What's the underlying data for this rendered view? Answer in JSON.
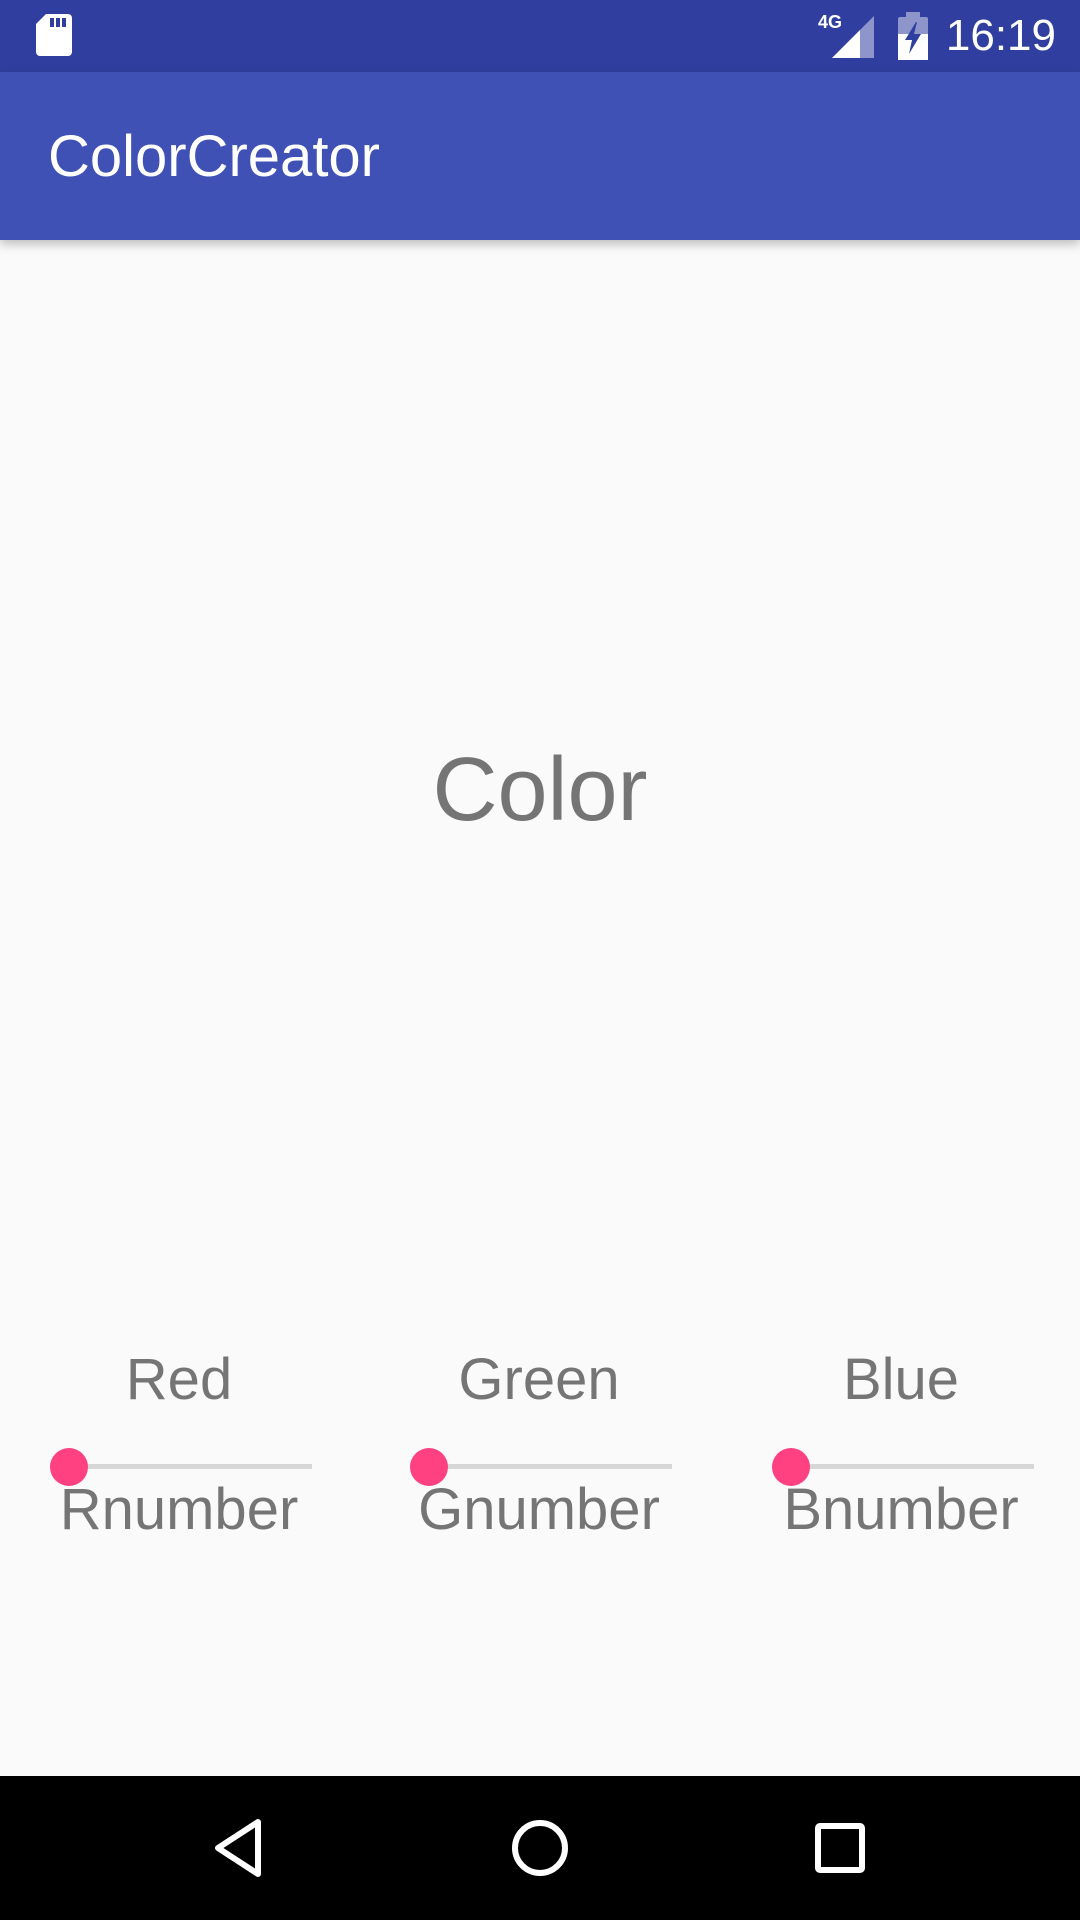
{
  "status_bar": {
    "time": "16:19",
    "network": "4G",
    "icons": [
      "sd-card-icon",
      "signal-4g-icon",
      "battery-charging-icon"
    ]
  },
  "app_bar": {
    "title": "ColorCreator"
  },
  "main": {
    "color_label": "Color",
    "channels": [
      {
        "name": "Red",
        "number_label": "Rnumber",
        "value": 0
      },
      {
        "name": "Green",
        "number_label": "Gnumber",
        "value": 0
      },
      {
        "name": "Blue",
        "number_label": "Bnumber",
        "value": 0
      }
    ]
  },
  "nav_bar": {
    "icons": [
      "back-icon",
      "home-icon",
      "recents-icon"
    ]
  },
  "colors": {
    "status_bar": "#303f9f",
    "app_bar": "#3f51b5",
    "accent": "#ff4081",
    "text_secondary": "#757575",
    "background": "#fafafa"
  }
}
